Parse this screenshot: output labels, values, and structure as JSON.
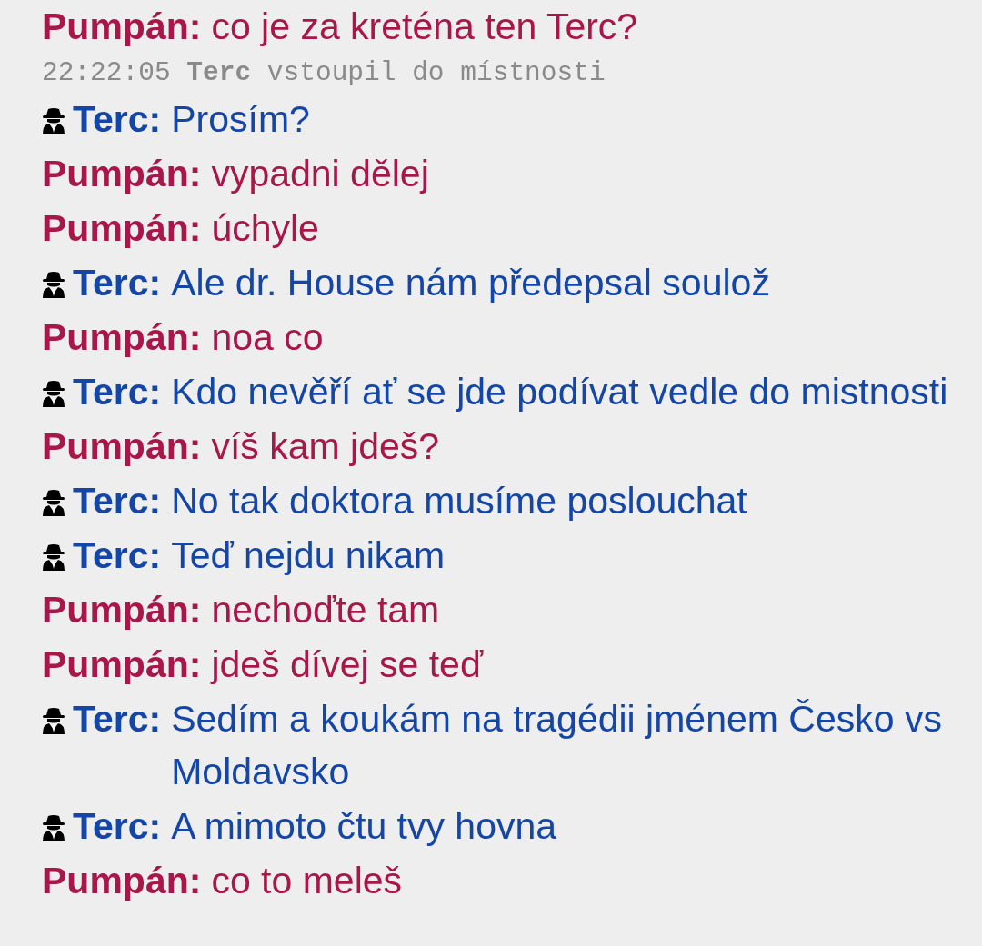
{
  "messages": [
    {
      "kind": "message",
      "author": "Pumpán:",
      "text": "co je za kreténa ten Terc?",
      "color": "#a8174a",
      "incognito": false
    },
    {
      "kind": "system",
      "time": "22:22:05",
      "author": "Terc",
      "text": "vstoupil do místnosti"
    },
    {
      "kind": "message",
      "author": "Terc:",
      "text": "Prosím?",
      "color": "#1446a8",
      "incognito": true
    },
    {
      "kind": "message",
      "author": "Pumpán:",
      "text": "vypadni dělej",
      "color": "#a8174a",
      "incognito": false
    },
    {
      "kind": "message",
      "author": "Pumpán:",
      "text": "úchyle",
      "color": "#a8174a",
      "incognito": false
    },
    {
      "kind": "message",
      "author": "Terc:",
      "text": "Ale dr. House nám předepsal soulož",
      "color": "#1446a8",
      "incognito": true
    },
    {
      "kind": "message",
      "author": "Pumpán:",
      "text": "noa co",
      "color": "#a8174a",
      "incognito": false
    },
    {
      "kind": "message",
      "author": "Terc:",
      "text": "Kdo nevěří ať se jde podívat vedle do mistnosti",
      "color": "#1446a8",
      "incognito": true
    },
    {
      "kind": "message",
      "author": "Pumpán:",
      "text": "víš kam jdeš?",
      "color": "#a8174a",
      "incognito": false
    },
    {
      "kind": "message",
      "author": "Terc:",
      "text": "No tak doktora musíme poslouchat",
      "color": "#1446a8",
      "incognito": true
    },
    {
      "kind": "message",
      "author": "Terc:",
      "text": "Teď nejdu nikam",
      "color": "#1446a8",
      "incognito": true
    },
    {
      "kind": "message",
      "author": "Pumpán:",
      "text": "nechoďte tam",
      "color": "#a8174a",
      "incognito": false
    },
    {
      "kind": "message",
      "author": "Pumpán:",
      "text": "jdeš dívej se teď",
      "color": "#a8174a",
      "incognito": false
    },
    {
      "kind": "message",
      "author": "Terc:",
      "text": "Sedím a koukám na tragédii jménem Česko vs Moldavsko",
      "color": "#1446a8",
      "incognito": true
    },
    {
      "kind": "message",
      "author": "Terc:",
      "text": "A mimoto čtu tvy hovna",
      "color": "#1446a8",
      "incognito": true
    },
    {
      "kind": "message",
      "author": "Pumpán:",
      "text": "co to meleš",
      "color": "#a8174a",
      "incognito": false
    }
  ]
}
